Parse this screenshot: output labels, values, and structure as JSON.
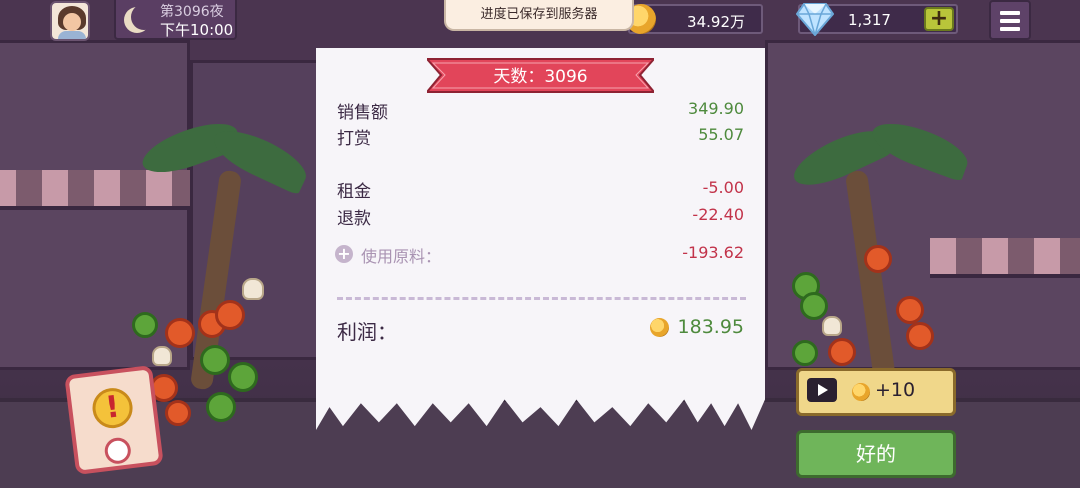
{
  "hud": {
    "night_label": "第3096夜",
    "time_label": "下午10:00",
    "toast": "进度已保存到服务器",
    "coins": "34.92万",
    "gems": "1,317",
    "gem_add_label": "+"
  },
  "receipt": {
    "title": "天数：3096",
    "sales_label": "销售额",
    "sales_value": "349.90",
    "tips_label": "打赏",
    "tips_value": "55.07",
    "rent_label": "租金",
    "rent_value": "-5.00",
    "refund_label": "退款",
    "refund_value": "-22.40",
    "ingredients_label": "使用原料：",
    "ingredients_value": "-193.62",
    "profit_label": "利润：",
    "profit_value": "183.95"
  },
  "buttons": {
    "ad_reward": "+10",
    "ok": "好的"
  },
  "colors": {
    "positive": "#4e8a3d",
    "negative": "#c2334a",
    "banner": "#e2455a"
  }
}
